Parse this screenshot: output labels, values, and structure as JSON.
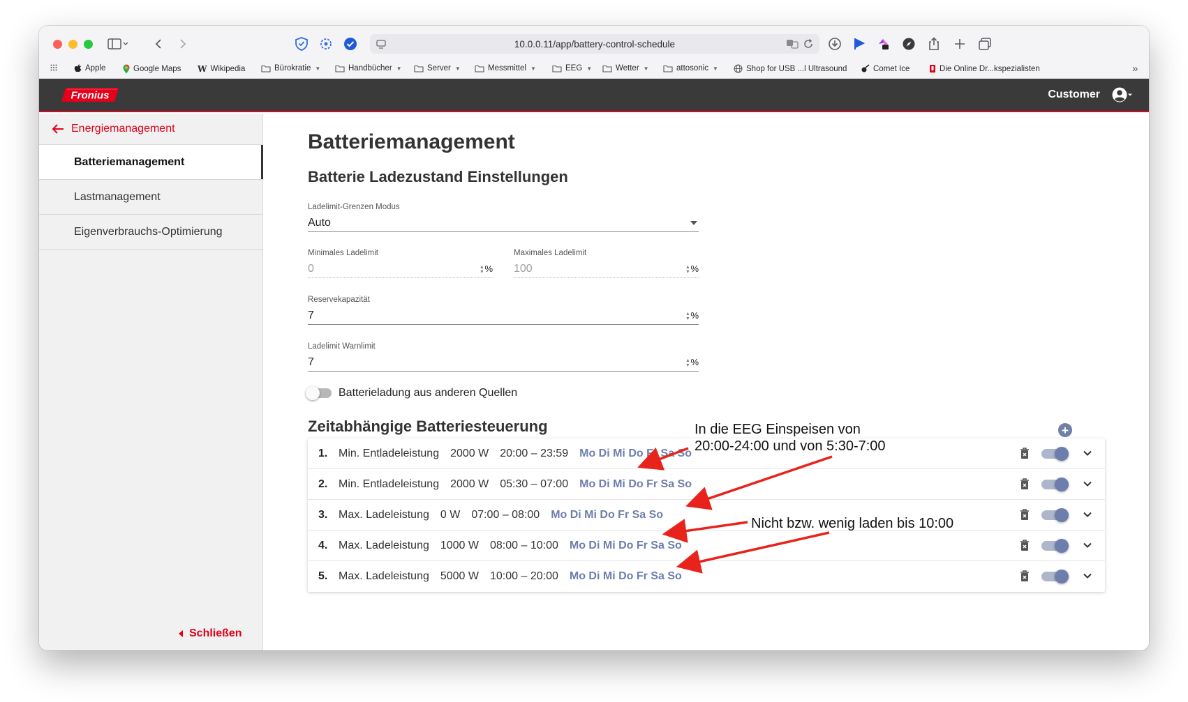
{
  "browser": {
    "url": "10.0.0.11/app/battery-control-schedule",
    "bookmarks": [
      {
        "label": "Apple",
        "icon": "apple-icon",
        "caret": false
      },
      {
        "label": "Google Maps",
        "icon": "map-pin-icon",
        "caret": false
      },
      {
        "label": "Wikipedia",
        "icon": "wikipedia-icon",
        "caret": false
      },
      {
        "label": "Bürokratie",
        "icon": "folder-icon",
        "caret": true
      },
      {
        "label": "Handbücher",
        "icon": "folder-icon",
        "caret": true
      },
      {
        "label": "Server",
        "icon": "folder-icon",
        "caret": true
      },
      {
        "label": "Messmittel",
        "icon": "folder-icon",
        "caret": true
      },
      {
        "label": "EEG",
        "icon": "folder-icon",
        "caret": true
      },
      {
        "label": "Wetter",
        "icon": "folder-icon",
        "caret": true
      },
      {
        "label": "attosonic",
        "icon": "folder-icon",
        "caret": true
      },
      {
        "label": "Shop for USB ...l Ultrasound",
        "icon": "globe-icon",
        "caret": false
      },
      {
        "label": "Comet Ice",
        "icon": "comet-icon",
        "caret": false
      },
      {
        "label": "Die Online Dr...kspezialisten",
        "icon": "bookmark-red-icon",
        "caret": false
      }
    ]
  },
  "header": {
    "logo_text": "Fronius",
    "user_label": "Customer"
  },
  "sidebar": {
    "back_label": "Energiemanagement",
    "items": [
      {
        "label": "Batteriemanagement",
        "active": true
      },
      {
        "label": "Lastmanagement",
        "active": false
      },
      {
        "label": "Eigenverbrauchs-Optimierung",
        "active": false
      }
    ],
    "close_label": "Schließen"
  },
  "main": {
    "title": "Batteriemanagement",
    "section_soc": "Batterie Ladezustand Einstellungen",
    "mode": {
      "label": "Ladelimit-Grenzen Modus",
      "value": "Auto"
    },
    "min_limit": {
      "label": "Minimales Ladelimit",
      "value": "0",
      "unit": "%"
    },
    "max_limit": {
      "label": "Maximales Ladelimit",
      "value": "100",
      "unit": "%"
    },
    "reserve": {
      "label": "Reservekapazität",
      "value": "7",
      "unit": "%"
    },
    "warn_limit": {
      "label": "Ladelimit Warnlimit",
      "value": "7",
      "unit": "%"
    },
    "other_sources_label": "Batterieladung aus anderen Quellen",
    "section_schedule": "Zeitabhängige Batteriesteuerung",
    "schedule": [
      {
        "num": "1.",
        "type": "Min. Entladeleistung",
        "power": "2000 W",
        "time": "20:00 – 23:59",
        "days": "Mo Di Mi Do Fr Sa So"
      },
      {
        "num": "2.",
        "type": "Min. Entladeleistung",
        "power": "2000 W",
        "time": "05:30 – 07:00",
        "days": "Mo Di Mi Do Fr Sa So"
      },
      {
        "num": "3.",
        "type": "Max. Ladeleistung",
        "power": "0 W",
        "time": "07:00 – 08:00",
        "days": "Mo Di Mi Do Fr Sa So"
      },
      {
        "num": "4.",
        "type": "Max. Ladeleistung",
        "power": "1000 W",
        "time": "08:00 – 10:00",
        "days": "Mo Di Mi Do Fr Sa So"
      },
      {
        "num": "5.",
        "type": "Max. Ladeleistung",
        "power": "5000 W",
        "time": "10:00 – 20:00",
        "days": "Mo Di Mi Do Fr Sa So"
      }
    ]
  },
  "annotations": {
    "note1_line1": "In die EEG Einspeisen von",
    "note1_line2": "20:00-24:00 und von 5:30-7:00",
    "note2": "Nicht bzw. wenig laden bis 10:00",
    "arrow_color": "#e8231c"
  }
}
